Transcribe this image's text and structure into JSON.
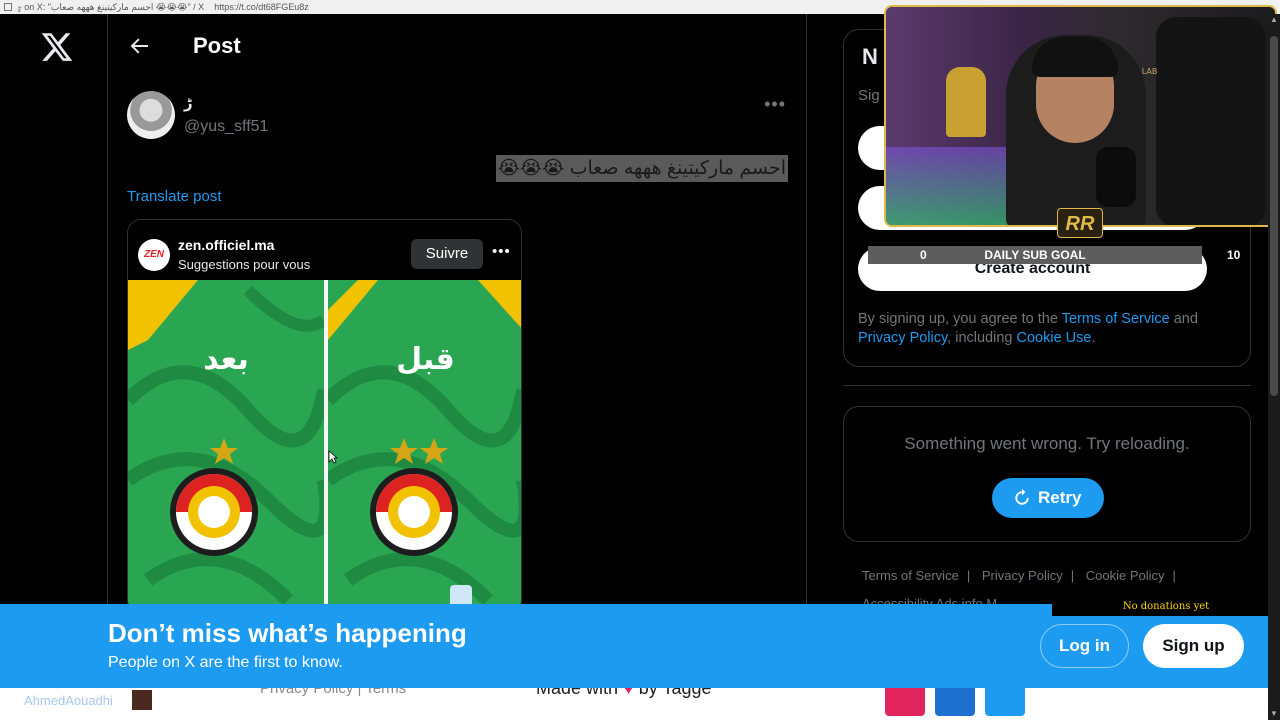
{
  "browser": {
    "tab_text": "𝓏 on X: \"احسم ماركيتينغ هههه صعاب 😭😭😭\" / X",
    "url": "https://t.co/dt68FGEu8z"
  },
  "header": {
    "title": "Post"
  },
  "post": {
    "display_name": "ڑ",
    "handle": "@yus_sff51",
    "text": "احسم ماركيتينغ هههه صعاب 😭😭😭",
    "translate_label": "Translate post"
  },
  "card": {
    "logo_text": "ZEN",
    "username": "zen.officiel.ma",
    "subtitle": "Suggestions pour vous",
    "follow_label": "Suivre",
    "left_label": "بعد",
    "right_label": "قبل"
  },
  "sidebar": {
    "signup_title": "N",
    "signup_sub": "Sig",
    "create_account_label": "Create account",
    "terms_prefix": "By signing up, you agree to the ",
    "terms_link": "Terms of Service",
    "terms_and": " and ",
    "privacy_link": "Privacy Policy",
    "terms_including": ", including ",
    "cookie_link": "Cookie Use",
    "terms_end": ".",
    "error_text": "Something went wrong. Try reloading.",
    "retry_label": "Retry",
    "footer": [
      "Terms of Service",
      "Privacy Policy",
      "Cookie Policy"
    ],
    "footer2": [
      "Accessibility",
      "Ads info",
      "M"
    ]
  },
  "overlay": {
    "badge": "RR",
    "chair_logo": "SECRET LAB",
    "subgoal_min": "0",
    "subgoal_label": "DAILY SUB GOAL",
    "subgoal_max": "10",
    "subgoal_progress": 0,
    "donations": "No donations yet"
  },
  "banner": {
    "title": "Don’t miss what’s happening",
    "subtitle": "People on X are the first to know.",
    "login_label": "Log in",
    "signup_label": "Sign up"
  },
  "bottom": {
    "stream_name": "AhmedAouadhi",
    "links": "Privacy Policy | Terms",
    "made_with": "Made with",
    "made_by": " by Tagge"
  },
  "colors": {
    "accent": "#1d9bf0",
    "background": "#000000",
    "muted": "#71767b",
    "border": "#2f3336"
  }
}
